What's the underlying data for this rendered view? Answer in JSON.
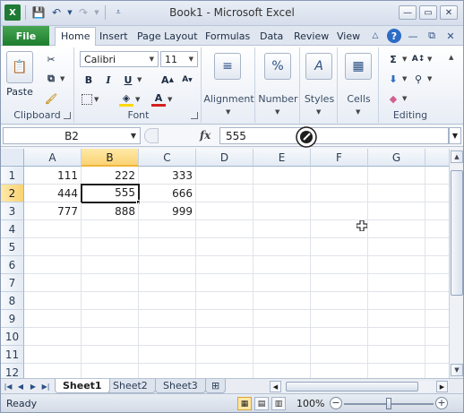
{
  "window": {
    "title": "Book1 - Microsoft Excel"
  },
  "quick_access": {
    "icons": [
      "excel-icon",
      "save-icon",
      "undo-icon",
      "redo-icon",
      "customize-icon"
    ]
  },
  "tabs": [
    {
      "label": "File"
    },
    {
      "label": "Home"
    },
    {
      "label": "Insert"
    },
    {
      "label": "Page Layout"
    },
    {
      "label": "Formulas"
    },
    {
      "label": "Data"
    },
    {
      "label": "Review"
    },
    {
      "label": "View"
    }
  ],
  "ribbon": {
    "clipboard": {
      "label": "Clipboard",
      "paste": "Paste"
    },
    "font": {
      "label": "Font",
      "name": "Calibri",
      "size": "11",
      "bold": "B",
      "italic": "I",
      "underline": "U"
    },
    "alignment": {
      "label": "Alignment"
    },
    "number": {
      "label": "Number",
      "symbol": "%"
    },
    "styles": {
      "label": "Styles"
    },
    "cells": {
      "label": "Cells"
    },
    "editing": {
      "label": "Editing"
    }
  },
  "formula_bar": {
    "name_box": "B2",
    "fx": "fx",
    "value": "555"
  },
  "grid": {
    "columns": [
      "A",
      "B",
      "C",
      "D",
      "E",
      "F",
      "G"
    ],
    "rows": [
      "1",
      "2",
      "3",
      "4",
      "5",
      "6",
      "7",
      "8",
      "9",
      "10",
      "11",
      "12"
    ],
    "selected_column": "B",
    "selected_row": "2",
    "cells": [
      [
        "111",
        "222",
        "333"
      ],
      [
        "444",
        "555",
        "666"
      ],
      [
        "777",
        "888",
        "999"
      ]
    ]
  },
  "sheets": [
    {
      "label": "Sheet1"
    },
    {
      "label": "Sheet2"
    },
    {
      "label": "Sheet3"
    }
  ],
  "status": {
    "ready": "Ready",
    "zoom": "100%"
  },
  "colors": {
    "file_tab": "#2a8a3a",
    "selected_header": "#f9d374",
    "accent": "#2b4f83"
  }
}
